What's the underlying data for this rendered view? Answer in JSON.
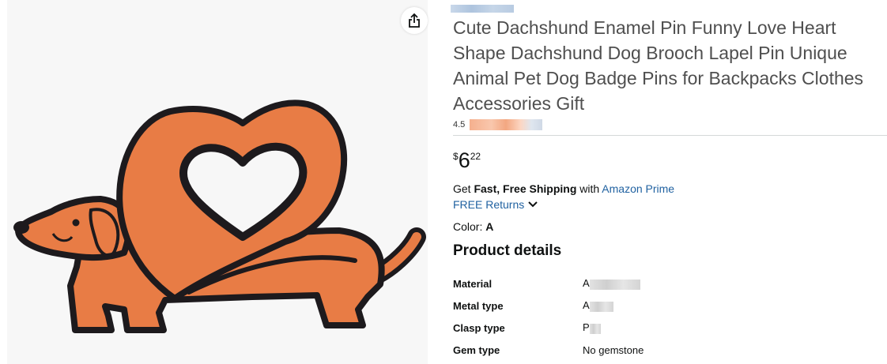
{
  "image_panel": {
    "share_icon": "share-icon"
  },
  "product": {
    "store_link": "",
    "title": "Cute Dachshund Enamel Pin Funny Love Heart Shape Dachshund Dog Brooch Lapel Pin Unique Animal Pet Dog Badge Pins for Backpacks Clothes Accessories Gift",
    "rating": "4.5",
    "price": {
      "symbol": "$",
      "whole": "6",
      "fraction": "22"
    },
    "shipping": {
      "prefix": "Get ",
      "bold": "Fast, Free Shipping",
      "middle": " with ",
      "prime": "Amazon Prime"
    },
    "returns": {
      "label": "FREE Returns",
      "icon": "chevron-down-icon"
    },
    "color": {
      "label": "Color: ",
      "value": "A"
    }
  },
  "details": {
    "heading": "Product details",
    "rows": [
      {
        "key": "Material",
        "value": "A"
      },
      {
        "key": "Metal type",
        "value": "A"
      },
      {
        "key": "Clasp type",
        "value": "P"
      },
      {
        "key": "Gem type",
        "value": "No gemstone"
      }
    ]
  },
  "colors": {
    "accent_link": "#2162a1",
    "pin_orange": "#e87c45",
    "title_gray": "#4f4f4f"
  }
}
